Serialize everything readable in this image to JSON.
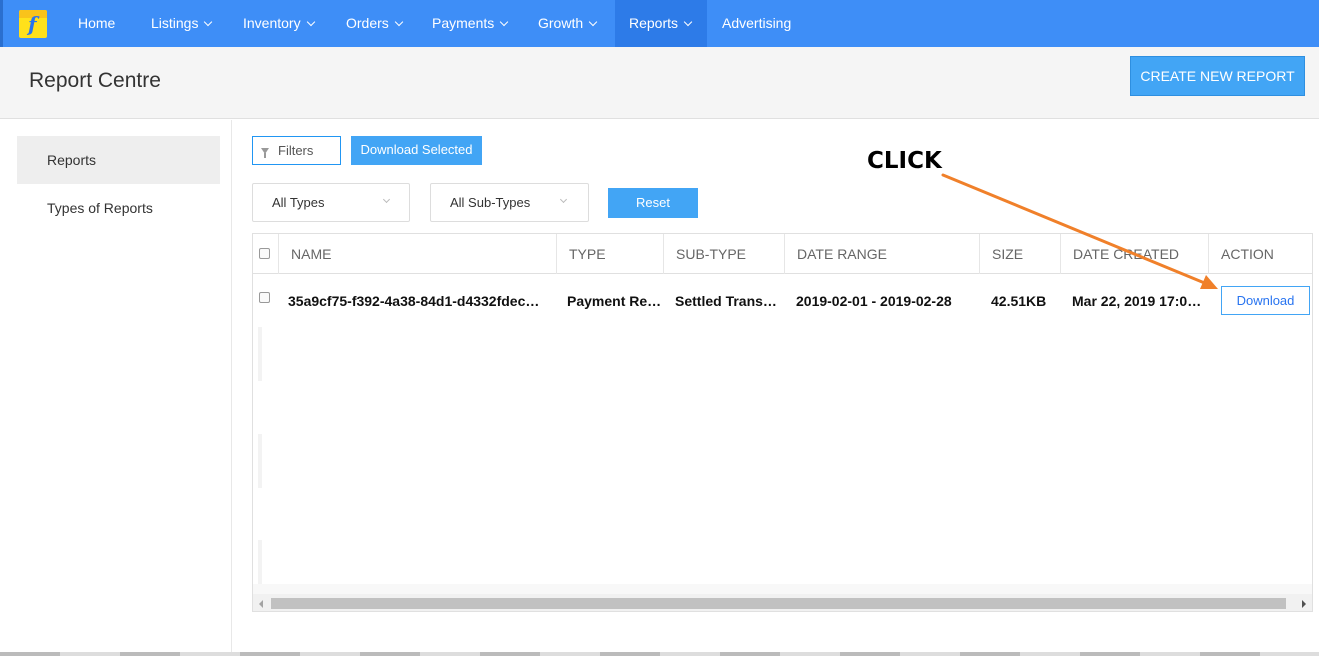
{
  "nav": {
    "items": [
      {
        "label": "Home",
        "has_dropdown": false
      },
      {
        "label": "Listings",
        "has_dropdown": true
      },
      {
        "label": "Inventory",
        "has_dropdown": true
      },
      {
        "label": "Orders",
        "has_dropdown": true
      },
      {
        "label": "Payments",
        "has_dropdown": true
      },
      {
        "label": "Growth",
        "has_dropdown": true
      },
      {
        "label": "Reports",
        "has_dropdown": true,
        "active": true
      },
      {
        "label": "Advertising",
        "has_dropdown": false
      }
    ],
    "bar_color": "#3e8ef7"
  },
  "header": {
    "title": "Report Centre",
    "create_button": "CREATE NEW REPORT"
  },
  "sidebar": {
    "items": [
      {
        "label": "Reports",
        "active": true
      },
      {
        "label": "Types of Reports",
        "active": false
      }
    ]
  },
  "toolbar": {
    "filters_label": "Filters",
    "download_selected_label": "Download Selected",
    "type_select_value": "All Types",
    "subtype_select_value": "All Sub-Types",
    "reset_label": "Reset"
  },
  "table": {
    "columns": [
      "NAME",
      "TYPE",
      "SUB-TYPE",
      "DATE RANGE",
      "SIZE",
      "DATE CREATED",
      "ACTION"
    ],
    "rows": [
      {
        "name": "35a9cf75-f392-4a38-84d1-d4332fdec…",
        "type": "Payment Re…",
        "sub_type": "Settled Trans…",
        "date_range": "2019-02-01 - 2019-02-28",
        "size": "42.51KB",
        "date_created": "Mar 22, 2019 17:0…",
        "action": "Download"
      }
    ]
  },
  "annotation": {
    "text": "CLICK",
    "arrow_color": "#f0802a"
  }
}
